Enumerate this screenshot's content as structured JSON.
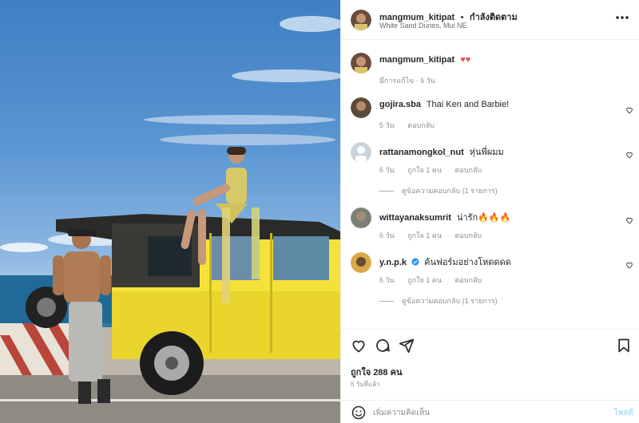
{
  "post": {
    "username": "mangmum_kitipat",
    "follow_status": "กำลังติดตาม",
    "location": "White Sand Dunes, Mui NE"
  },
  "caption": {
    "username": "mangmum_kitipat",
    "text": "♥♥",
    "meta": "มีการแก้ไข · 6 วัน"
  },
  "comments": [
    {
      "username": "gojira.sba",
      "verified": false,
      "text": "Thai Ken and Barbie!",
      "age": "5 วัน",
      "likes": "",
      "reply": "ตอบกลับ",
      "view_replies": ""
    },
    {
      "username": "rattanamongkol_nut",
      "verified": false,
      "text": "หุ่นพี่ผมม",
      "age": "6 วัน",
      "likes": "ถูกใจ 1 คน",
      "reply": "ตอบกลับ",
      "view_replies": "ดูข้อความตอบกลับ (1 รายการ)"
    },
    {
      "username": "wittayanaksumrit",
      "verified": false,
      "text": "น่ารัก🔥🔥🔥",
      "age": "6 วัน",
      "likes": "ถูกใจ 1 คน",
      "reply": "ตอบกลับ",
      "view_replies": ""
    },
    {
      "username": "y.n.p.k",
      "verified": true,
      "text": "ค้นฟอร์มอย่างโหดดดด",
      "age": "6 วัน",
      "likes": "ถูกใจ 1 คน",
      "reply": "ตอบกลับ",
      "view_replies": "ดูข้อความตอบกลับ (1 รายการ)"
    }
  ],
  "footer": {
    "likes_label": "ถูกใจ 288 คน",
    "time_label": "6 วันที่แล้ว",
    "comment_placeholder": "เพิ่มความคิดเห็น",
    "post_button": "โพสต์"
  },
  "icons": {
    "more": "more-options-icon",
    "like": "heart-icon",
    "comment": "comment-icon",
    "share": "share-icon",
    "save": "bookmark-icon",
    "emoji": "emoji-icon",
    "verified": "verified-badge-icon"
  },
  "colors": {
    "text": "#262626",
    "muted": "#8e8e8e",
    "post_button": "#b2dffc",
    "verified": "#3897f0",
    "heart_red": "#ed4956"
  }
}
